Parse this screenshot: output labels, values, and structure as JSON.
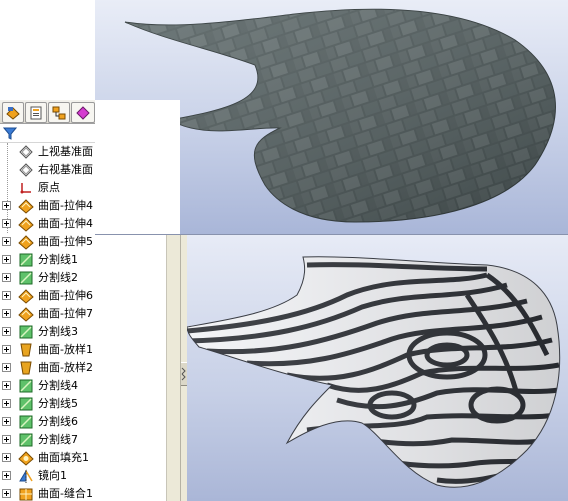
{
  "window": {
    "panel_tabs": [
      {
        "icon": "feature-tree-icon"
      },
      {
        "icon": "property-manager-icon"
      },
      {
        "icon": "configuration-manager-icon"
      },
      {
        "icon": "display-manager-icon"
      }
    ],
    "filter_icon": "filter-icon"
  },
  "tree": {
    "items": [
      {
        "label": "上视基准面",
        "icon": "plane-icon",
        "expandable": false
      },
      {
        "label": "右视基准面",
        "icon": "plane-icon",
        "expandable": false
      },
      {
        "label": "原点",
        "icon": "origin-icon",
        "expandable": false
      },
      {
        "label": "曲面-拉伸4",
        "icon": "surface-extrude-icon",
        "expandable": true
      },
      {
        "label": "曲面-拉伸4",
        "icon": "surface-extrude-icon",
        "expandable": true
      },
      {
        "label": "曲面-拉伸5",
        "icon": "surface-extrude-icon",
        "expandable": true
      },
      {
        "label": "分割线1",
        "icon": "split-line-icon",
        "expandable": true
      },
      {
        "label": "分割线2",
        "icon": "split-line-icon",
        "expandable": true
      },
      {
        "label": "曲面-拉伸6",
        "icon": "surface-extrude-icon",
        "expandable": true
      },
      {
        "label": "曲面-拉伸7",
        "icon": "surface-extrude-icon",
        "expandable": true
      },
      {
        "label": "分割线3",
        "icon": "split-line-icon",
        "expandable": true
      },
      {
        "label": "曲面-放样1",
        "icon": "surface-loft-icon",
        "expandable": true
      },
      {
        "label": "曲面-放样2",
        "icon": "surface-loft-icon",
        "expandable": true
      },
      {
        "label": "分割线4",
        "icon": "split-line-icon",
        "expandable": true
      },
      {
        "label": "分割线5",
        "icon": "split-line-icon",
        "expandable": true
      },
      {
        "label": "分割线6",
        "icon": "split-line-icon",
        "expandable": true
      },
      {
        "label": "分割线7",
        "icon": "split-line-icon",
        "expandable": true
      },
      {
        "label": "曲面填充1",
        "icon": "surface-fill-icon",
        "expandable": true
      },
      {
        "label": "镜向1",
        "icon": "mirror-icon",
        "expandable": true
      },
      {
        "label": "曲面-缝合1",
        "icon": "surface-knit-icon",
        "expandable": true
      }
    ]
  },
  "colors": {
    "extrude": "#f0a21e",
    "split": "#2e9a3a",
    "loft": "#e8a420",
    "stone": "#4d5a5b",
    "zebra_dark": "#2c2f35",
    "zebra_light": "#f2f3f6"
  }
}
